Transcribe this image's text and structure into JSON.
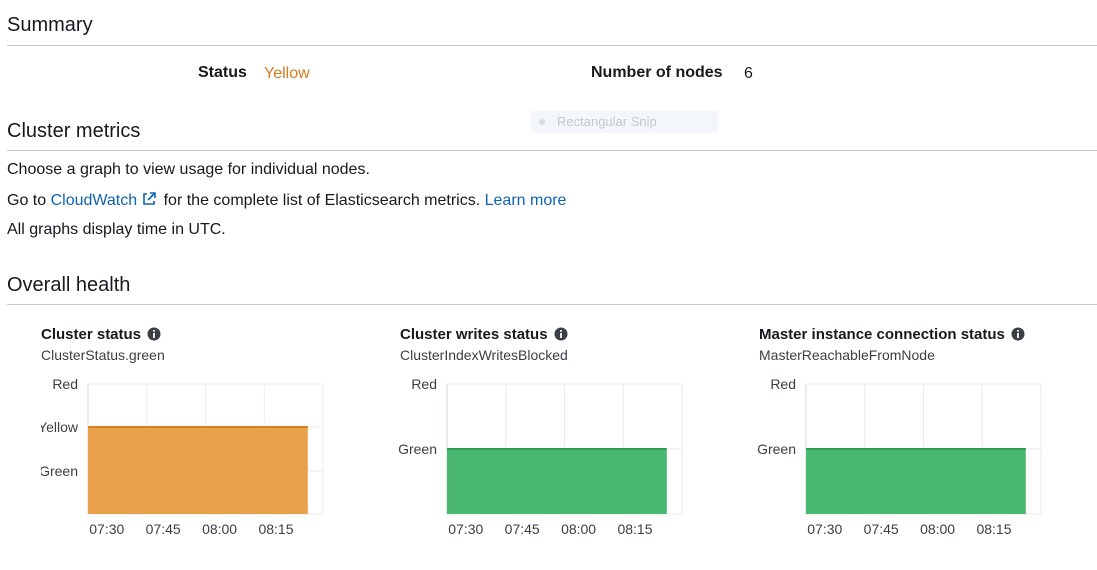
{
  "summary": {
    "title": "Summary",
    "status_label": "Status",
    "status_value": "Yellow",
    "nodes_label": "Number of nodes",
    "nodes_value": "6"
  },
  "overlay": {
    "text": "Rectangular Snip"
  },
  "metrics": {
    "title": "Cluster metrics",
    "line1": "Choose a graph to view usage for individual nodes.",
    "line2_prefix": "Go to",
    "cloudwatch_link": "CloudWatch",
    "line2_suffix": "for the complete list of Elasticsearch metrics.",
    "learn_more_link": "Learn more",
    "line3": "All graphs display time in UTC."
  },
  "health": {
    "title": "Overall health",
    "panels": [
      {
        "title": "Cluster status",
        "metric": "ClusterStatus.green",
        "chart_data": {
          "type": "area",
          "categories": [
            "Red",
            "Yellow",
            "Green"
          ],
          "x": [
            "07:30",
            "07:45",
            "08:00",
            "08:15"
          ],
          "value": "Yellow",
          "color": "#e8a04a",
          "line_color": "#d97f1c",
          "end_fraction": 0.88
        }
      },
      {
        "title": "Cluster writes status",
        "metric": "ClusterIndexWritesBlocked",
        "chart_data": {
          "type": "area",
          "categories": [
            "Red",
            "Green"
          ],
          "x": [
            "07:30",
            "07:45",
            "08:00",
            "08:15"
          ],
          "value": "Green",
          "color": "#4bb871",
          "line_color": "#2c9c52",
          "end_fraction": 0.88
        }
      },
      {
        "title": "Master instance connection status",
        "metric": "MasterReachableFromNode",
        "chart_data": {
          "type": "area",
          "categories": [
            "Red",
            "Green"
          ],
          "x": [
            "07:30",
            "07:45",
            "08:00",
            "08:15"
          ],
          "value": "Green",
          "color": "#4bb871",
          "line_color": "#2c9c52",
          "end_fraction": 0.88
        }
      }
    ]
  }
}
